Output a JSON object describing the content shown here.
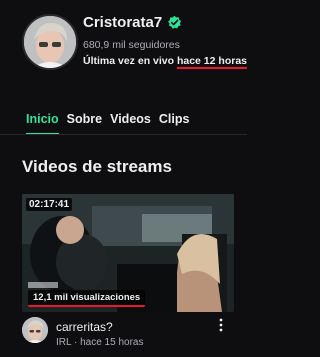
{
  "channel": {
    "name": "Cristorata7",
    "followers": "680,9 mil seguidores",
    "last_live_prefix": "Última vez en vivo ",
    "last_live_time": "hace 12 horas"
  },
  "tabs": [
    {
      "label": "Inicio",
      "active": true
    },
    {
      "label": "Sobre",
      "active": false
    },
    {
      "label": "Videos",
      "active": false
    },
    {
      "label": "Clips",
      "active": false
    }
  ],
  "section": {
    "title": "Videos de streams"
  },
  "video": {
    "duration": "02:17:41",
    "views": "12,1 mil visualizaciones",
    "title": "carreritas?",
    "meta": "IRL · hace 15 horas"
  },
  "icons": {
    "verified": "verified-check-icon",
    "more": "more-vertical-icon"
  },
  "colors": {
    "background": "#0e0e10",
    "accent": "#2ee39a",
    "verified": "#2ee39a",
    "highlight": "#e9192c"
  }
}
